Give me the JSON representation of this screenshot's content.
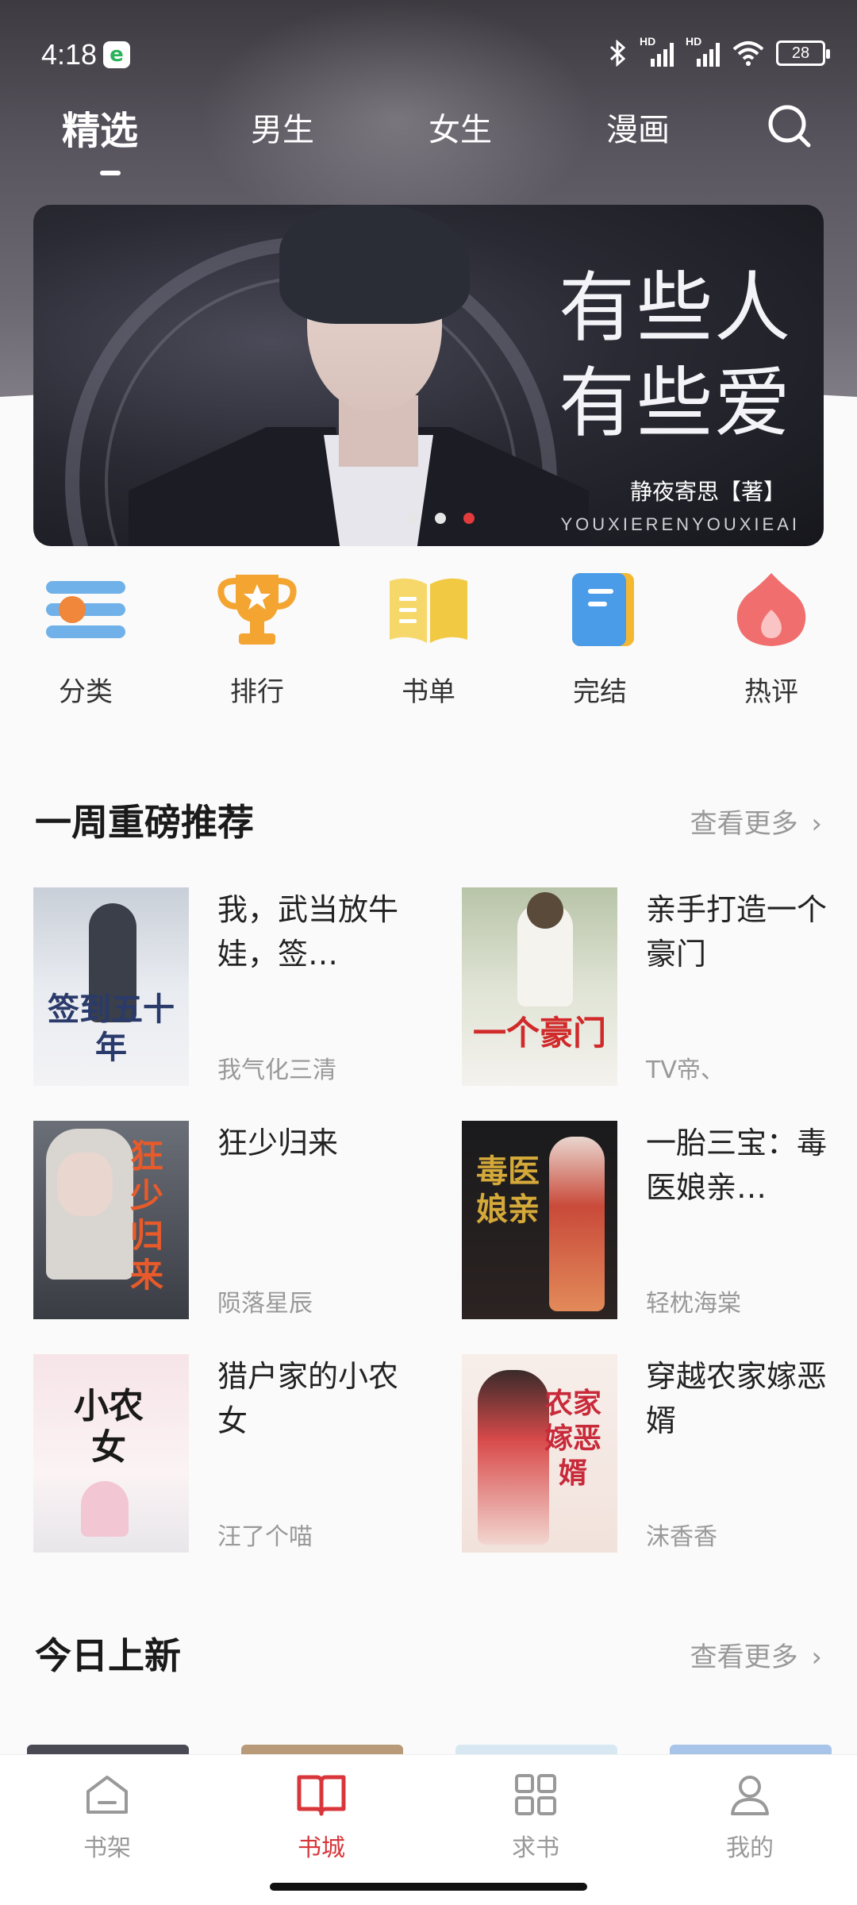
{
  "status_bar": {
    "time": "4:18",
    "app_badge": "e",
    "battery": "28",
    "hd_label_1": "HD",
    "hd_label_2": "HD"
  },
  "top_tabs": [
    {
      "label": "精选",
      "active": true
    },
    {
      "label": "男生",
      "active": false
    },
    {
      "label": "女生",
      "active": false
    },
    {
      "label": "漫画",
      "active": false
    }
  ],
  "banner": {
    "line1": "有些人",
    "line2": "有些爱",
    "author": "静夜寄思【著】",
    "pinyin": "YOUXIERENYOUXIEAI",
    "dots": 3,
    "active_dot": 3
  },
  "categories": [
    {
      "label": "分类",
      "icon": "category-icon"
    },
    {
      "label": "排行",
      "icon": "trophy-icon"
    },
    {
      "label": "书单",
      "icon": "book-list-icon"
    },
    {
      "label": "完结",
      "icon": "finished-icon"
    },
    {
      "label": "热评",
      "icon": "flame-icon"
    }
  ],
  "weekly": {
    "title": "一周重磅推荐",
    "more": "查看更多",
    "books": [
      {
        "title": "我，武当放牛娃，签…",
        "author": "我气化三清",
        "cover_text": "签到五十年"
      },
      {
        "title": "亲手打造一个豪门",
        "author": "TV帝、",
        "cover_text": "一个豪门"
      },
      {
        "title": "狂少归来",
        "author": "陨落星辰",
        "cover_text": "狂少归来"
      },
      {
        "title": "一胎三宝：毒医娘亲…",
        "author": "轻枕海棠",
        "cover_text": "毒医娘亲"
      },
      {
        "title": "猎户家的小农女",
        "author": "汪了个喵",
        "cover_text": "小农女"
      },
      {
        "title": "穿越农家嫁恶婿",
        "author": "沫香香",
        "cover_text": "农家嫁恶婿"
      }
    ]
  },
  "today": {
    "title": "今日上新",
    "more": "查看更多"
  },
  "bottom_nav": [
    {
      "label": "书架",
      "icon": "bookshelf-icon",
      "active": false
    },
    {
      "label": "书城",
      "icon": "book-store-icon",
      "active": true
    },
    {
      "label": "求书",
      "icon": "request-book-icon",
      "active": false
    },
    {
      "label": "我的",
      "icon": "profile-icon",
      "active": false
    }
  ],
  "colors": {
    "accent": "#d8363a",
    "header_dark": "#3d3a40",
    "muted_text": "#999999"
  }
}
